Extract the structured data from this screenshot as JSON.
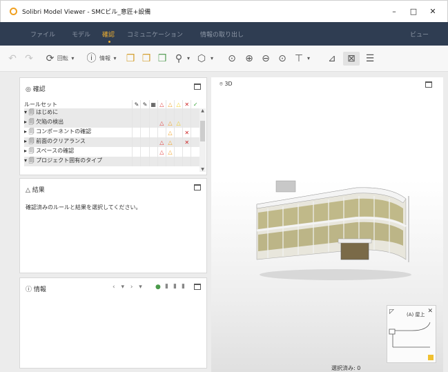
{
  "window": {
    "title": "Solibri Model Viewer - SMCビル_意匠+設備",
    "minimize": "–",
    "maximize": "□",
    "close": "✕"
  },
  "menu": {
    "items": [
      "ファイル",
      "モデル",
      "確認",
      "コミュニケーション",
      "情報の取り出し"
    ],
    "right": "ビュー",
    "active": "確認"
  },
  "toolbar": {
    "undo": "↶",
    "redo": "↷",
    "rotate_label": "回転",
    "info_label": "情報",
    "zoom_fit": "⊙",
    "zoom_in": "⊕",
    "zoom_out": "⊖",
    "zoom_window": "⊙",
    "select": "⊤",
    "dropdown": "▾"
  },
  "check_panel": {
    "title": "確認",
    "col_header": "ルールセット",
    "rows": [
      {
        "label": "▾ 🗐 はじめに",
        "c1": "",
        "c2": "",
        "c3": "",
        "c4": "",
        "c5": "",
        "c6": ""
      },
      {
        "label": "▸ 🗐 欠陥の検出",
        "c1": "",
        "c2": "",
        "c3": "△",
        "c4": "△",
        "c5": "△",
        "c6": ""
      },
      {
        "label": "▸ 🗐 コンポーネントの確認",
        "c1": "",
        "c2": "",
        "c3": "",
        "c4": "△",
        "c5": "",
        "c6": "✕"
      },
      {
        "label": "▸ 🗐 前面のクリアランス",
        "c1": "",
        "c2": "",
        "c3": "△",
        "c4": "△",
        "c5": "",
        "c6": "✕"
      },
      {
        "label": "▸ 🗐 スペースの確認",
        "c1": "",
        "c2": "",
        "c3": "△",
        "c4": "△",
        "c5": "",
        "c6": ""
      },
      {
        "label": "▾ 🗐 プロジェクト固有のタイプ",
        "c1": "",
        "c2": "",
        "c3": "",
        "c4": "",
        "c5": "",
        "c6": ""
      }
    ]
  },
  "result_panel": {
    "title": "結果",
    "message": "確認済みのルールと結果を選択してください。"
  },
  "info_panel": {
    "title": "情報",
    "nav": "‹ ▾ › ▾"
  },
  "view3d": {
    "title": "3D",
    "status": "選択済み: 0"
  },
  "minimap": {
    "label": "(A) 屋上"
  }
}
